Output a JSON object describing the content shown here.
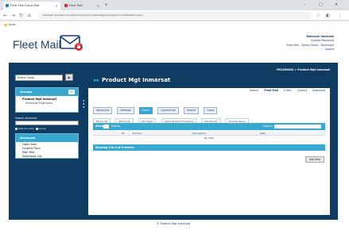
{
  "browser": {
    "tabs": [
      {
        "label": "Fleet Mail Group Mgt",
        "active": true
      },
      {
        "label": "Fleet Mail",
        "active": false
      }
    ],
    "new_tab": "+",
    "controls": {
      "minimize": "–",
      "maximize": "▢",
      "close": "✕"
    },
    "url": "fleetmail.example.com/Admin/Group/GroupManagement.aspx?id=1000&tab=Users",
    "bookmark": "Apps"
  },
  "header": {
    "logo": "Fleet Mail",
    "welcome": "Welcome Inmarsat",
    "links_line1": "Change Password",
    "links_line2": "Fleet Mail · Select Group · Download",
    "logout": "Logout"
  },
  "sidebar": {
    "search_value": "Select Group",
    "go": "▶",
    "groups_title": "Groups",
    "group_name": "Product Mgt Inmarsat",
    "group_sub": "Inmarsat Engineers",
    "search_label": "Search Accounts",
    "radio1": "Ship Account",
    "radio2": "Group",
    "menu_title": "Accounts",
    "menu_items": [
      "Open Item",
      "Quoted Time",
      "Mail Test",
      "Download List"
    ]
  },
  "main": {
    "title": "Product Mgt Inmarsat",
    "ids": "FM1000000 > Product Mgt Inmarsat",
    "top_tabs": [
      "Search",
      "Fleet Mail",
      "E-Mail",
      "Contact",
      "Download"
    ],
    "tabs": [
      "Advanced",
      "Settings",
      "Users",
      "Quarantine",
      "Search",
      "Costs"
    ],
    "subtabs": [
      "Block List",
      "Allow List",
      "Set Agent",
      "Optional Email Forwards",
      "Set Priority",
      "Domain Rules"
    ],
    "grid": {
      "show_label": "Show",
      "show_value": "10",
      "entries_label": "entries",
      "search_label": "Search:",
      "columns": [
        "ID",
        "Domain",
        "Description",
        "Date"
      ],
      "empty": "No data",
      "footer": "Showing 0 to 0 of 0 entries"
    },
    "add_button": "Add New"
  },
  "footer": "© Product Mgt Inmarsat"
}
